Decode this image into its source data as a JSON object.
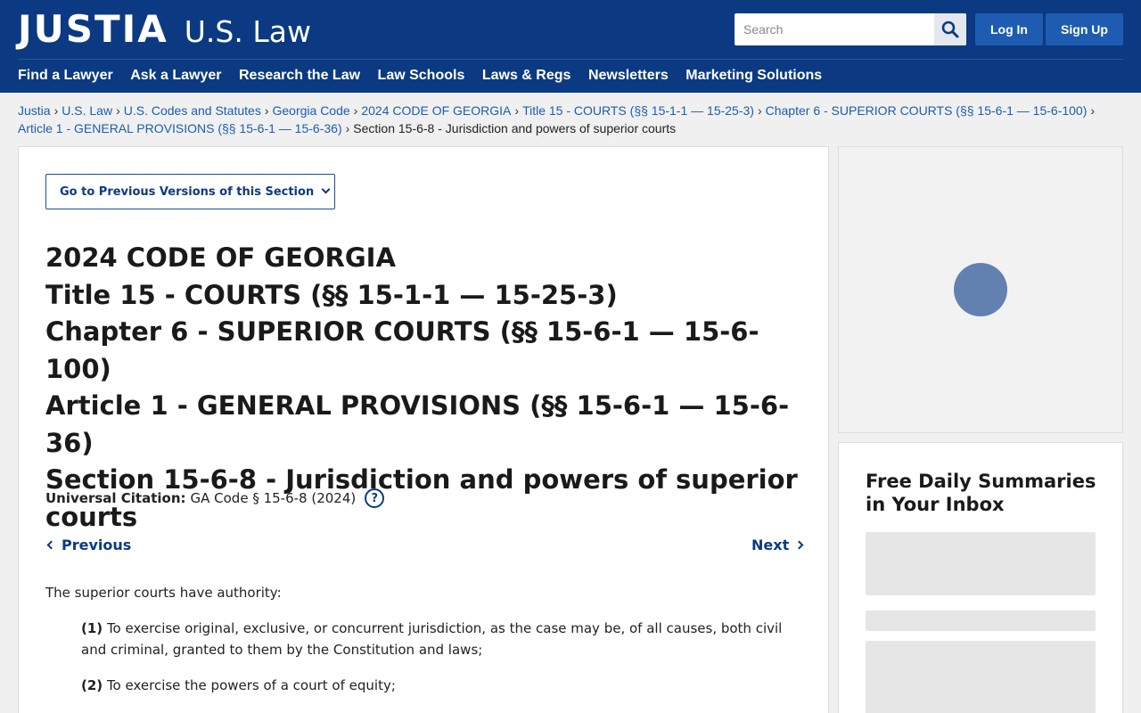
{
  "header": {
    "logo_main": "JUSTIA",
    "logo_sub": "U.S. Law",
    "search_placeholder": "Search",
    "login_label": "Log In",
    "signup_label": "Sign Up",
    "nav": [
      "Find a Lawyer",
      "Ask a Lawyer",
      "Research the Law",
      "Law Schools",
      "Laws & Regs",
      "Newsletters",
      "Marketing Solutions"
    ]
  },
  "breadcrumb": {
    "items": [
      "Justia",
      "U.S. Law",
      "U.S. Codes and Statutes",
      "Georgia Code",
      "2024 CODE OF GEORGIA",
      "Title 15 - COURTS (§§ 15-1-1 — 15-25-3)",
      "Chapter 6 - SUPERIOR COURTS (§§ 15-6-1 — 15-6-100)",
      "Article 1 - GENERAL PROVISIONS (§§ 15-6-1 — 15-6-36)"
    ],
    "current": "Section 15-6-8 - Jurisdiction and powers of superior courts"
  },
  "main": {
    "prev_versions_label": "Go to Previous Versions of this Section",
    "titles": [
      "2024 CODE OF GEORGIA",
      "Title 15 - COURTS (§§ 15-1-1 — 15-25-3)",
      "Chapter 6 - SUPERIOR COURTS (§§ 15-6-1 — 15-6-100)",
      "Article 1 - GENERAL PROVISIONS (§§ 15-6-1 — 15-6-36)",
      "Section 15-6-8 - Jurisdiction and powers of superior courts"
    ],
    "citation_label": "Universal Citation:",
    "citation_value": "GA Code § 15-6-8 (2024)",
    "help_glyph": "?",
    "previous_label": "Previous",
    "next_label": "Next",
    "intro": "The superior courts have authority:",
    "items": [
      {
        "num": "(1)",
        "text": "To exercise original, exclusive, or concurrent jurisdiction, as the case may be, of all causes, both civil and criminal, granted to them by the Constitution and laws;"
      },
      {
        "num": "(2)",
        "text": "To exercise the powers of a court of equity;"
      }
    ]
  },
  "sidebar": {
    "newsletter_title": "Free Daily Summaries in Your Inbox"
  },
  "colors": {
    "header_bg": "#0b3a82",
    "button_bg": "#1d5cb0",
    "link": "#1d5cb0",
    "spinner": "#6381b0"
  }
}
